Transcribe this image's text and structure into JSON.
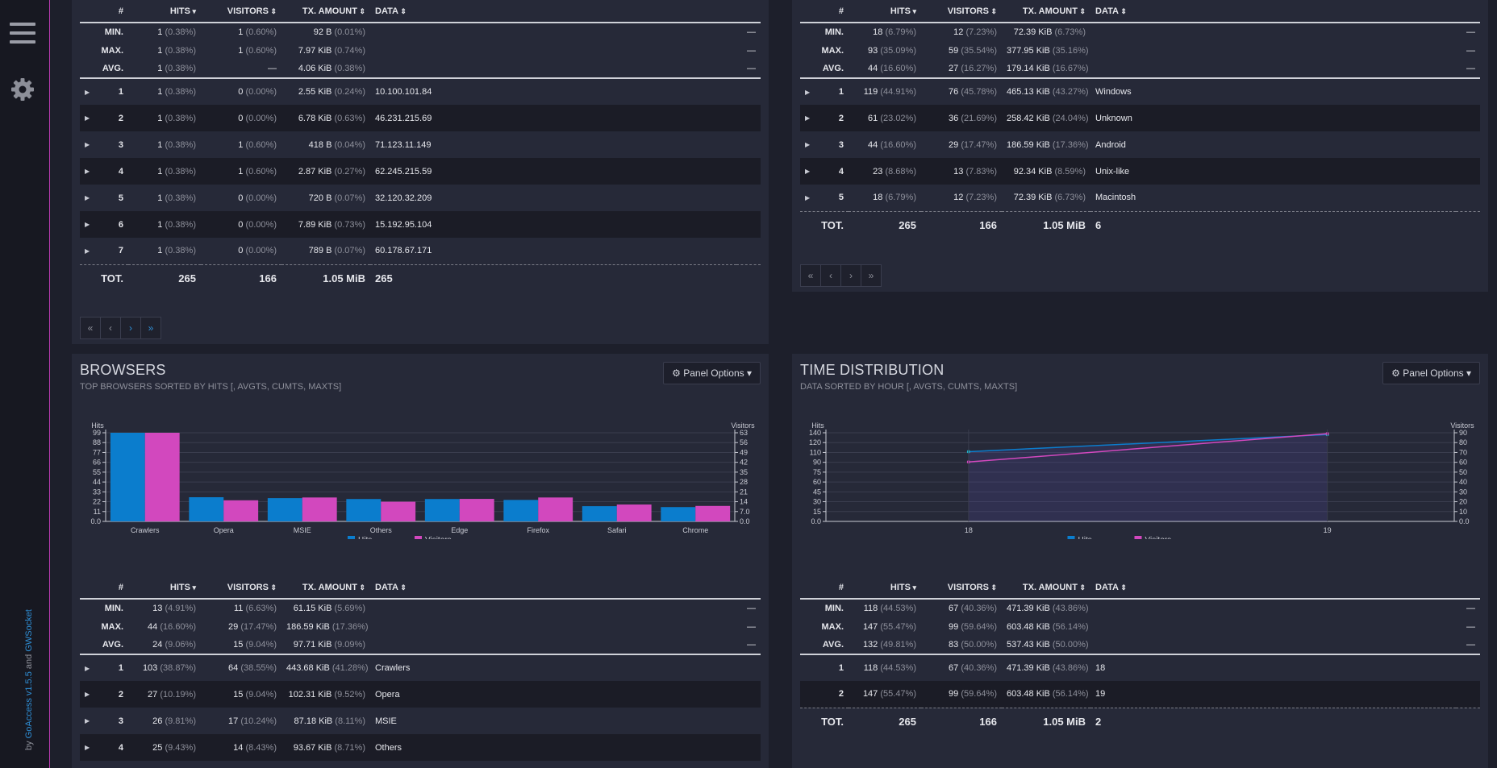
{
  "app": {
    "credits_prefix": "by ",
    "credits_goaccess": "GoAccess",
    "credits_version": " v1.5.5",
    "credits_and": " and ",
    "credits_gwsocket": "GWSocket"
  },
  "hosts_table": {
    "columns": [
      "#",
      "HITS",
      "VISITORS",
      "TX. AMOUNT",
      "DATA"
    ],
    "meta": [
      {
        "label": "MIN.",
        "hits": "1",
        "hits_pct": "(0.38%)",
        "visitors": "1",
        "visitors_pct": "(0.60%)",
        "tx": "92 B",
        "tx_pct": "(0.01%)",
        "data": "—"
      },
      {
        "label": "MAX.",
        "hits": "1",
        "hits_pct": "(0.38%)",
        "visitors": "1",
        "visitors_pct": "(0.60%)",
        "tx": "7.97 KiB",
        "tx_pct": "(0.74%)",
        "data": "—"
      },
      {
        "label": "AVG.",
        "hits": "1",
        "hits_pct": "(0.38%)",
        "visitors": "—",
        "visitors_pct": "",
        "tx": "4.06 KiB",
        "tx_pct": "(0.38%)",
        "data": "—"
      }
    ],
    "rows": [
      {
        "n": "1",
        "hits": "1",
        "hits_pct": "(0.38%)",
        "visitors": "0",
        "visitors_pct": "(0.00%)",
        "tx": "2.55 KiB",
        "tx_pct": "(0.24%)",
        "data": "10.100.101.84"
      },
      {
        "n": "2",
        "hits": "1",
        "hits_pct": "(0.38%)",
        "visitors": "0",
        "visitors_pct": "(0.00%)",
        "tx": "6.78 KiB",
        "tx_pct": "(0.63%)",
        "data": "46.231.215.69"
      },
      {
        "n": "3",
        "hits": "1",
        "hits_pct": "(0.38%)",
        "visitors": "1",
        "visitors_pct": "(0.60%)",
        "tx": "418 B",
        "tx_pct": "(0.04%)",
        "data": "71.123.11.149"
      },
      {
        "n": "4",
        "hits": "1",
        "hits_pct": "(0.38%)",
        "visitors": "1",
        "visitors_pct": "(0.60%)",
        "tx": "2.87 KiB",
        "tx_pct": "(0.27%)",
        "data": "62.245.215.59"
      },
      {
        "n": "5",
        "hits": "1",
        "hits_pct": "(0.38%)",
        "visitors": "0",
        "visitors_pct": "(0.00%)",
        "tx": "720 B",
        "tx_pct": "(0.07%)",
        "data": "32.120.32.209"
      },
      {
        "n": "6",
        "hits": "1",
        "hits_pct": "(0.38%)",
        "visitors": "0",
        "visitors_pct": "(0.00%)",
        "tx": "7.89 KiB",
        "tx_pct": "(0.73%)",
        "data": "15.192.95.104"
      },
      {
        "n": "7",
        "hits": "1",
        "hits_pct": "(0.38%)",
        "visitors": "0",
        "visitors_pct": "(0.00%)",
        "tx": "789 B",
        "tx_pct": "(0.07%)",
        "data": "60.178.67.171"
      }
    ],
    "total": {
      "label": "TOT.",
      "hits": "265",
      "visitors": "166",
      "tx": "1.05 MiB",
      "data": "265"
    }
  },
  "os_table": {
    "columns": [
      "#",
      "HITS",
      "VISITORS",
      "TX. AMOUNT",
      "DATA"
    ],
    "meta": [
      {
        "label": "MIN.",
        "hits": "18",
        "hits_pct": "(6.79%)",
        "visitors": "12",
        "visitors_pct": "(7.23%)",
        "tx": "72.39 KiB",
        "tx_pct": "(6.73%)",
        "data": "—"
      },
      {
        "label": "MAX.",
        "hits": "93",
        "hits_pct": "(35.09%)",
        "visitors": "59",
        "visitors_pct": "(35.54%)",
        "tx": "377.95 KiB",
        "tx_pct": "(35.16%)",
        "data": "—"
      },
      {
        "label": "AVG.",
        "hits": "44",
        "hits_pct": "(16.60%)",
        "visitors": "27",
        "visitors_pct": "(16.27%)",
        "tx": "179.14 KiB",
        "tx_pct": "(16.67%)",
        "data": "—"
      }
    ],
    "rows": [
      {
        "n": "1",
        "hits": "119",
        "hits_pct": "(44.91%)",
        "visitors": "76",
        "visitors_pct": "(45.78%)",
        "tx": "465.13 KiB",
        "tx_pct": "(43.27%)",
        "data": "Windows"
      },
      {
        "n": "2",
        "hits": "61",
        "hits_pct": "(23.02%)",
        "visitors": "36",
        "visitors_pct": "(21.69%)",
        "tx": "258.42 KiB",
        "tx_pct": "(24.04%)",
        "data": "Unknown"
      },
      {
        "n": "3",
        "hits": "44",
        "hits_pct": "(16.60%)",
        "visitors": "29",
        "visitors_pct": "(17.47%)",
        "tx": "186.59 KiB",
        "tx_pct": "(17.36%)",
        "data": "Android"
      },
      {
        "n": "4",
        "hits": "23",
        "hits_pct": "(8.68%)",
        "visitors": "13",
        "visitors_pct": "(7.83%)",
        "tx": "92.34 KiB",
        "tx_pct": "(8.59%)",
        "data": "Unix-like"
      },
      {
        "n": "5",
        "hits": "18",
        "hits_pct": "(6.79%)",
        "visitors": "12",
        "visitors_pct": "(7.23%)",
        "tx": "72.39 KiB",
        "tx_pct": "(6.73%)",
        "data": "Macintosh"
      }
    ],
    "total": {
      "label": "TOT.",
      "hits": "265",
      "visitors": "166",
      "tx": "1.05 MiB",
      "data": "6"
    }
  },
  "pager": {
    "first": "«",
    "prev": "‹",
    "next": "›",
    "last": "»"
  },
  "browsers": {
    "title": "BROWSERS",
    "subtitle": "TOP BROWSERS SORTED BY HITS [, AVGTS, CUMTS, MAXTS]",
    "panel_options": "Panel Options",
    "columns": [
      "#",
      "HITS",
      "VISITORS",
      "TX. AMOUNT",
      "DATA"
    ],
    "meta": [
      {
        "label": "MIN.",
        "hits": "13",
        "hits_pct": "(4.91%)",
        "visitors": "11",
        "visitors_pct": "(6.63%)",
        "tx": "61.15 KiB",
        "tx_pct": "(5.69%)",
        "data": "—"
      },
      {
        "label": "MAX.",
        "hits": "44",
        "hits_pct": "(16.60%)",
        "visitors": "29",
        "visitors_pct": "(17.47%)",
        "tx": "186.59 KiB",
        "tx_pct": "(17.36%)",
        "data": "—"
      },
      {
        "label": "AVG.",
        "hits": "24",
        "hits_pct": "(9.06%)",
        "visitors": "15",
        "visitors_pct": "(9.04%)",
        "tx": "97.71 KiB",
        "tx_pct": "(9.09%)",
        "data": "—"
      }
    ],
    "rows": [
      {
        "n": "1",
        "hits": "103",
        "hits_pct": "(38.87%)",
        "visitors": "64",
        "visitors_pct": "(38.55%)",
        "tx": "443.68 KiB",
        "tx_pct": "(41.28%)",
        "data": "Crawlers"
      },
      {
        "n": "2",
        "hits": "27",
        "hits_pct": "(10.19%)",
        "visitors": "15",
        "visitors_pct": "(9.04%)",
        "tx": "102.31 KiB",
        "tx_pct": "(9.52%)",
        "data": "Opera"
      },
      {
        "n": "3",
        "hits": "26",
        "hits_pct": "(9.81%)",
        "visitors": "17",
        "visitors_pct": "(10.24%)",
        "tx": "87.18 KiB",
        "tx_pct": "(8.11%)",
        "data": "MSIE"
      },
      {
        "n": "4",
        "hits": "25",
        "hits_pct": "(9.43%)",
        "visitors": "14",
        "visitors_pct": "(8.43%)",
        "tx": "93.67 KiB",
        "tx_pct": "(8.71%)",
        "data": "Others"
      }
    ]
  },
  "time_dist": {
    "title": "TIME DISTRIBUTION",
    "subtitle": "DATA SORTED BY HOUR [, AVGTS, CUMTS, MAXTS]",
    "panel_options": "Panel Options",
    "columns": [
      "#",
      "HITS",
      "VISITORS",
      "TX. AMOUNT",
      "DATA"
    ],
    "meta": [
      {
        "label": "MIN.",
        "hits": "118",
        "hits_pct": "(44.53%)",
        "visitors": "67",
        "visitors_pct": "(40.36%)",
        "tx": "471.39 KiB",
        "tx_pct": "(43.86%)",
        "data": "—"
      },
      {
        "label": "MAX.",
        "hits": "147",
        "hits_pct": "(55.47%)",
        "visitors": "99",
        "visitors_pct": "(59.64%)",
        "tx": "603.48 KiB",
        "tx_pct": "(56.14%)",
        "data": "—"
      },
      {
        "label": "AVG.",
        "hits": "132",
        "hits_pct": "(49.81%)",
        "visitors": "83",
        "visitors_pct": "(50.00%)",
        "tx": "537.43 KiB",
        "tx_pct": "(50.00%)",
        "data": "—"
      }
    ],
    "rows": [
      {
        "n": "1",
        "hits": "118",
        "hits_pct": "(44.53%)",
        "visitors": "67",
        "visitors_pct": "(40.36%)",
        "tx": "471.39 KiB",
        "tx_pct": "(43.86%)",
        "data": "18"
      },
      {
        "n": "2",
        "hits": "147",
        "hits_pct": "(55.47%)",
        "visitors": "99",
        "visitors_pct": "(59.64%)",
        "tx": "603.48 KiB",
        "tx_pct": "(56.14%)",
        "data": "19"
      }
    ],
    "total": {
      "label": "TOT.",
      "hits": "265",
      "visitors": "166",
      "tx": "1.05 MiB",
      "data": "2"
    }
  },
  "colors": {
    "hits": "#0b7dcd",
    "visitors": "#d248be",
    "accent": "#b93bb0",
    "link": "#2f8fd6"
  },
  "chart_data": [
    {
      "type": "bar",
      "categories": [
        "Crawlers",
        "Opera",
        "MSIE",
        "Others",
        "Edge",
        "Firefox",
        "Safari",
        "Chrome"
      ],
      "series": [
        {
          "name": "Hits",
          "axis": "left",
          "values": [
            103,
            27,
            26,
            25,
            25,
            24,
            17,
            16
          ]
        },
        {
          "name": "Visitors",
          "axis": "right",
          "values": [
            64,
            15,
            17,
            14,
            16,
            17,
            12,
            11
          ]
        }
      ],
      "ylabel_left": "Hits",
      "ylabel_right": "Visitors",
      "yticks_left": [
        "0.0",
        "11",
        "22",
        "33",
        "44",
        "55",
        "66",
        "77",
        "88",
        "99"
      ],
      "yticks_right": [
        "0.0",
        "7.0",
        "14",
        "21",
        "28",
        "35",
        "42",
        "49",
        "56",
        "63"
      ],
      "ylim_left": [
        0,
        99
      ],
      "ylim_right": [
        0,
        63
      ],
      "grid": true,
      "legend_position": "bottom"
    },
    {
      "type": "line",
      "categories": [
        "18",
        "19"
      ],
      "series": [
        {
          "name": "Hits",
          "axis": "left",
          "values": [
            118,
            147
          ]
        },
        {
          "name": "Visitors",
          "axis": "right",
          "values": [
            67,
            99
          ]
        }
      ],
      "ylabel_left": "Hits",
      "ylabel_right": "Visitors",
      "yticks_left": [
        "0.0",
        "15",
        "30",
        "45",
        "60",
        "75",
        "90",
        "110",
        "120",
        "140"
      ],
      "yticks_right": [
        "0.0",
        "10",
        "20",
        "30",
        "40",
        "50",
        "60",
        "70",
        "80",
        "90"
      ],
      "ylim_left": [
        0,
        150
      ],
      "ylim_right": [
        0,
        100
      ],
      "grid": true,
      "legend_position": "bottom"
    }
  ]
}
